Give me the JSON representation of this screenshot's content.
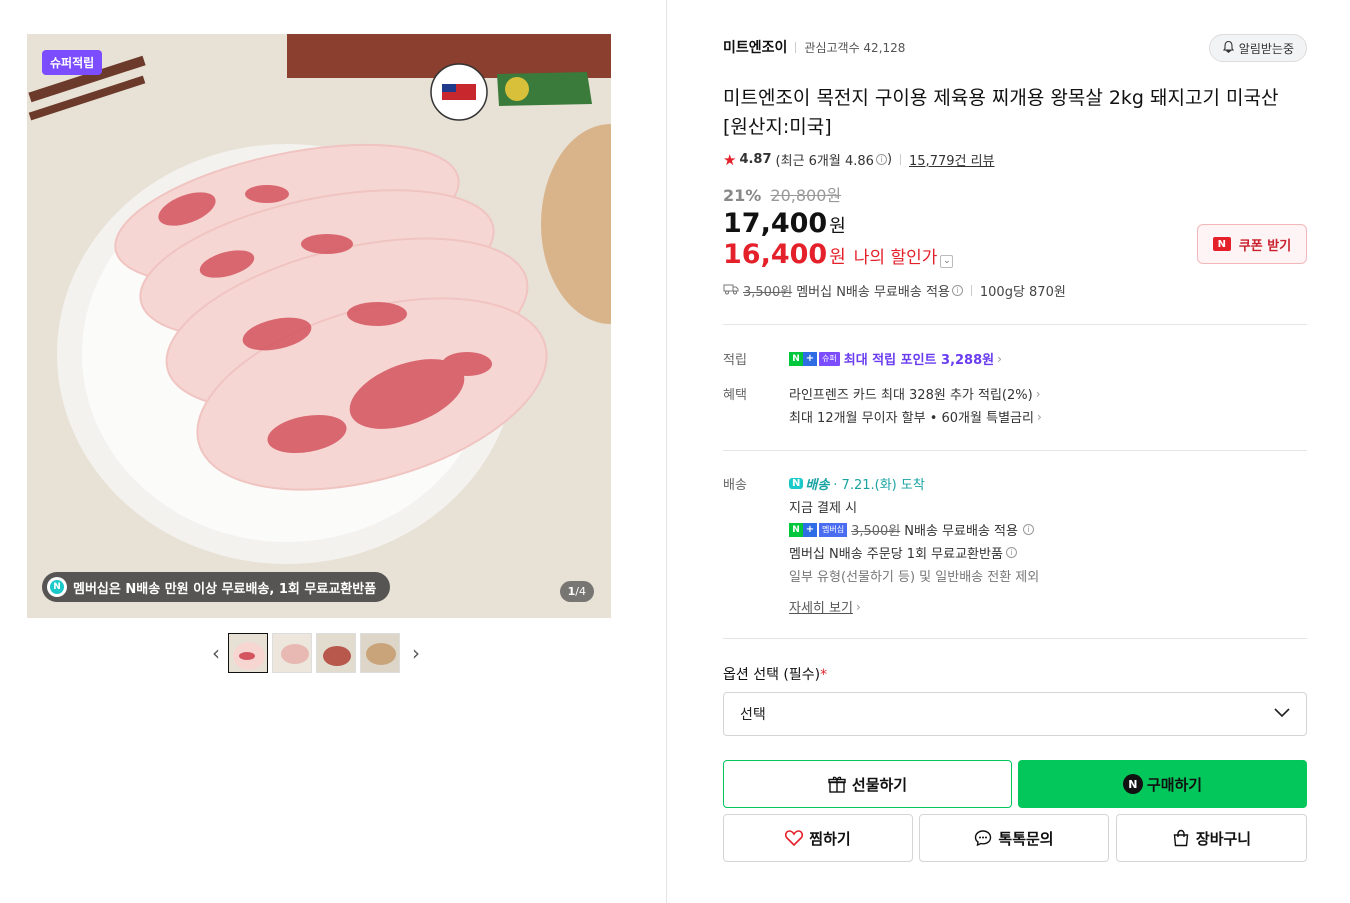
{
  "gallery": {
    "badge": "슈퍼적립",
    "banner_text": "멤버십은 N배송 만원 이상 무료배송, 1회 무료교환반품",
    "banner_icon": "N",
    "counter_current": "1",
    "counter_total": "/4",
    "logo_usmef": "U.S.MEAT EXPORT FEDERATION",
    "logo_nebraska": "NEBRASKA",
    "logo_nebraska_sub": "SOYBEAN BOARD",
    "thumbnail_count": 4,
    "active_thumbnail": 1
  },
  "seller": {
    "name": "미트엔조이",
    "followers_label": "관심고객수 42,128",
    "alarm_label": "알림받는중"
  },
  "product": {
    "title": "미트엔조이 목전지 구이용 제육용 찌개용 왕목살 2kg 돼지고기 미국산 [원산지:미국]",
    "rating": "4.87",
    "recent_rating": "(최근 6개월 4.86",
    "recent_rating_close": ")",
    "review_count": "15,779건 리뷰"
  },
  "price": {
    "discount_pct": "21%",
    "original": "20,800원",
    "sale": "17,400",
    "won": "원",
    "my_price": "16,400",
    "my_won": "원",
    "my_label": "나의 할인가",
    "coupon_label": "쿠폰 받기",
    "coupon_icon": "N"
  },
  "shipping_summary": {
    "old_fee": "3,500원",
    "text": "멤버십 N배송 무료배송 적용",
    "per_unit": "100g당 870원"
  },
  "benefits": {
    "points_label": "적립",
    "points_n": "N",
    "points_plus": "+",
    "points_super": "슈퍼",
    "points_text": "최대 적립 포인트 3,288원",
    "benefit_label": "혜택",
    "card_text": "라인프렌즈 카드 최대 328원 추가 적립(2%)",
    "installment_text": "최대 12개월 무이자 할부 • 60개월 특별금리"
  },
  "delivery": {
    "label": "배송",
    "badge_n": "N",
    "badge_text": "배송",
    "arrival": "· 7.21.(화) 도착",
    "pay_now": "지금 결제 시",
    "member_n": "N",
    "member_plus": "+",
    "member_chip": "멤버십",
    "old_fee": "3,500원",
    "free_text": "N배송 무료배송 적용",
    "exchange_text": "멤버십 N배송 주문당 1회 무료교환반품",
    "exclude_text": "일부 유형(선물하기 등) 및 일반배송 전환 제외",
    "details_link": "자세히 보기"
  },
  "options": {
    "label": "옵션 선택 (필수)",
    "required_mark": "*",
    "selected": "선택"
  },
  "actions": {
    "gift": "선물하기",
    "buy": "구매하기",
    "buy_icon": "N",
    "wish": "찜하기",
    "talk": "톡톡문의",
    "cart": "장바구니"
  },
  "colors": {
    "accent_green": "#03c75a",
    "price_red": "#e4212b",
    "super_purple": "#7b4dff"
  }
}
